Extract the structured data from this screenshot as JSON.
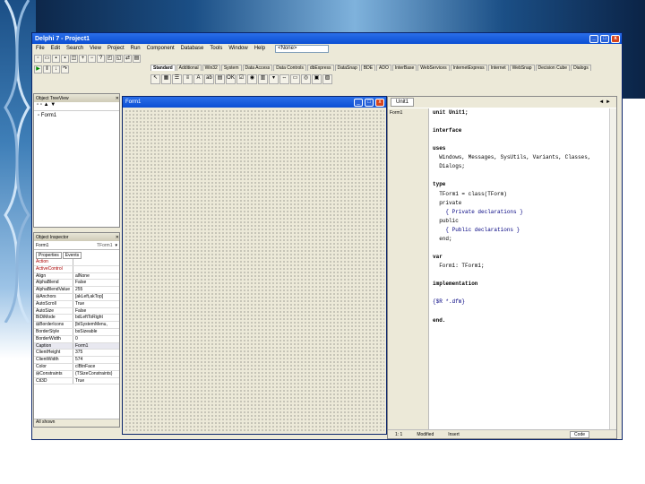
{
  "window": {
    "title": "Delphi 7 - Project1",
    "controls": [
      "_",
      "□",
      "x"
    ]
  },
  "menu": [
    "File",
    "Edit",
    "Search",
    "View",
    "Project",
    "Run",
    "Component",
    "Database",
    "Tools",
    "Window",
    "Help"
  ],
  "toolbar": {
    "desktop_combo": "<None>"
  },
  "palette": {
    "tabs": [
      "Standard",
      "Additional",
      "Win32",
      "System",
      "Data Access",
      "Data Controls",
      "dbExpress",
      "DataSnap",
      "BDE",
      "ADO",
      "InterBase",
      "WebServices",
      "InternetExpress",
      "Internet",
      "WebSnap",
      "Decision Cube",
      "Dialogs"
    ],
    "active_index": 0
  },
  "object_treeview": {
    "title": "Object TreeView",
    "items": [
      "Form1"
    ]
  },
  "object_inspector": {
    "title": "Object Inspector",
    "object_combo": "Form1",
    "object_type": "TForm1",
    "tabs": [
      "Properties",
      "Events"
    ],
    "rows": [
      {
        "name": "Action",
        "value": "",
        "hl": true
      },
      {
        "name": "ActiveControl",
        "value": "",
        "hl": true
      },
      {
        "name": "Align",
        "value": "alNone"
      },
      {
        "name": "AlphaBlend",
        "value": "False"
      },
      {
        "name": "AlphaBlendValue",
        "value": "255"
      },
      {
        "name": "⊞Anchors",
        "value": "[akLeft,akTop]"
      },
      {
        "name": "AutoScroll",
        "value": "True"
      },
      {
        "name": "AutoSize",
        "value": "False"
      },
      {
        "name": "BiDiMode",
        "value": "bdLeftToRight"
      },
      {
        "name": "⊞BorderIcons",
        "value": "[biSystemMenu,"
      },
      {
        "name": "BorderStyle",
        "value": "bsSizeable"
      },
      {
        "name": "BorderWidth",
        "value": "0"
      },
      {
        "name": "Caption",
        "value": "Form1",
        "sel": true
      },
      {
        "name": "ClientHeight",
        "value": "375"
      },
      {
        "name": "ClientWidth",
        "value": "574"
      },
      {
        "name": "Color",
        "value": "clBtnFace"
      },
      {
        "name": "⊞Constraints",
        "value": "(TSizeConstraints)"
      },
      {
        "name": "Ctl3D",
        "value": "True"
      }
    ],
    "status": "All shown"
  },
  "form_designer": {
    "title": "Form1"
  },
  "editor": {
    "tab": "Unit1",
    "code_lines": [
      {
        "t": "unit Unit1;",
        "c": "kw"
      },
      {
        "t": "",
        "c": ""
      },
      {
        "t": "interface",
        "c": "kw"
      },
      {
        "t": "",
        "c": ""
      },
      {
        "t": "uses",
        "c": "kw"
      },
      {
        "t": "  Windows, Messages, SysUtils, Variants, Classes,",
        "c": ""
      },
      {
        "t": "  Dialogs;",
        "c": ""
      },
      {
        "t": "",
        "c": ""
      },
      {
        "t": "type",
        "c": "kw"
      },
      {
        "t": "  TForm1 = class(TForm)",
        "c": ""
      },
      {
        "t": "  private",
        "c": ""
      },
      {
        "t": "    { Private declarations }",
        "c": "cm"
      },
      {
        "t": "  public",
        "c": ""
      },
      {
        "t": "    { Public declarations }",
        "c": "cm"
      },
      {
        "t": "  end;",
        "c": ""
      },
      {
        "t": "",
        "c": ""
      },
      {
        "t": "var",
        "c": "kw"
      },
      {
        "t": "  Form1: TForm1;",
        "c": ""
      },
      {
        "t": "",
        "c": ""
      },
      {
        "t": "implementation",
        "c": "kw"
      },
      {
        "t": "",
        "c": ""
      },
      {
        "t": "{$R *.dfm}",
        "c": "cm"
      },
      {
        "t": "",
        "c": ""
      },
      {
        "t": "end.",
        "c": "kw"
      }
    ],
    "gutter_item": "Form1",
    "status": {
      "pos": "1: 1",
      "state": "Modified",
      "mode": "Insert",
      "tab": "Code"
    }
  }
}
